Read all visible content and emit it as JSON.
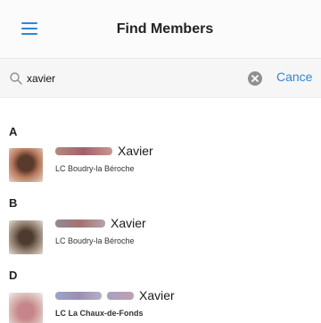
{
  "nav": {
    "title": "Find Members"
  },
  "search": {
    "value": "xavier",
    "cancel_label": "Cance"
  },
  "colors": {
    "accent": "#2f86d8"
  },
  "sections": [
    {
      "letter": "A",
      "member": {
        "name": "Xavier",
        "club": "LC Boudry-la Béroche"
      }
    },
    {
      "letter": "B",
      "member": {
        "name": "Xavier",
        "club": "LC Boudry-la Béroche"
      }
    },
    {
      "letter": "D",
      "member": {
        "name": "Xavier",
        "club": "LC La Chaux-de-Fonds"
      }
    }
  ],
  "icons": {
    "menu": "hamburger-menu-icon",
    "search": "magnifier-icon",
    "clear": "clear-x-circle-icon"
  }
}
